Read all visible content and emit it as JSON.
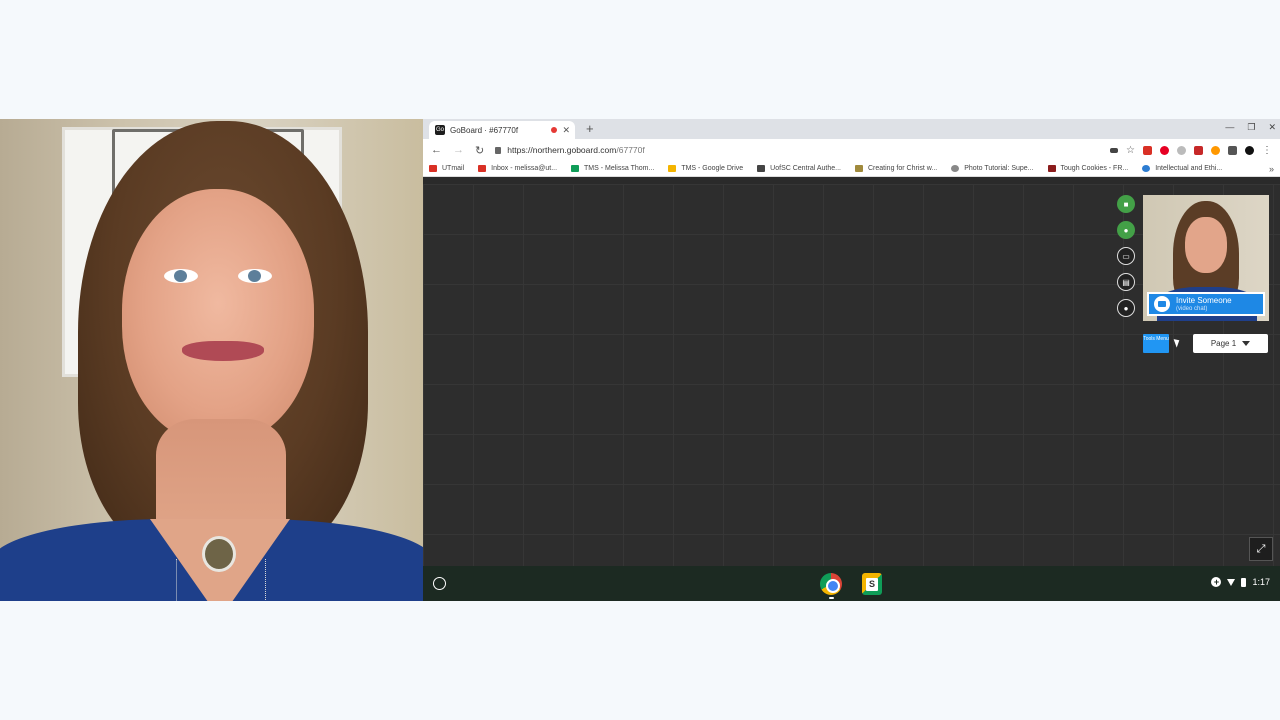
{
  "tab": {
    "favicon": "Go",
    "title": "GoBoard · #67770f"
  },
  "address": {
    "host": "https://northern.goboard.com",
    "path": "/67770f"
  },
  "bookmarks": [
    {
      "label": "UTmail",
      "color": "#d93025"
    },
    {
      "label": "Inbox - melissa@ut...",
      "color": "#d93025"
    },
    {
      "label": "TMS - Melissa Thom...",
      "color": "#0f9d58"
    },
    {
      "label": "TMS - Google Drive",
      "color": "#f4b400"
    },
    {
      "label": "UofSC Central Authe...",
      "color": "#444444"
    },
    {
      "label": "Creating for Christ w...",
      "color": "#a08a3c"
    },
    {
      "label": "Photo Tutorial: Supe...",
      "color": "#888888"
    },
    {
      "label": "Tough Cookies - FR...",
      "color": "#8b1c1c"
    },
    {
      "label": "Intellectual and Ethi...",
      "color": "#2d7dd2"
    }
  ],
  "board": {
    "tools": [
      "video-icon",
      "microphone-icon",
      "screen-share-icon",
      "gallery-icon",
      "chat-icon"
    ],
    "invite": {
      "title": "Invite Someone",
      "subtitle": "(video chat)"
    },
    "tools_menu": "Tools Menu",
    "page_selector": "Page 1"
  },
  "shelf": {
    "clock": "1:17"
  }
}
